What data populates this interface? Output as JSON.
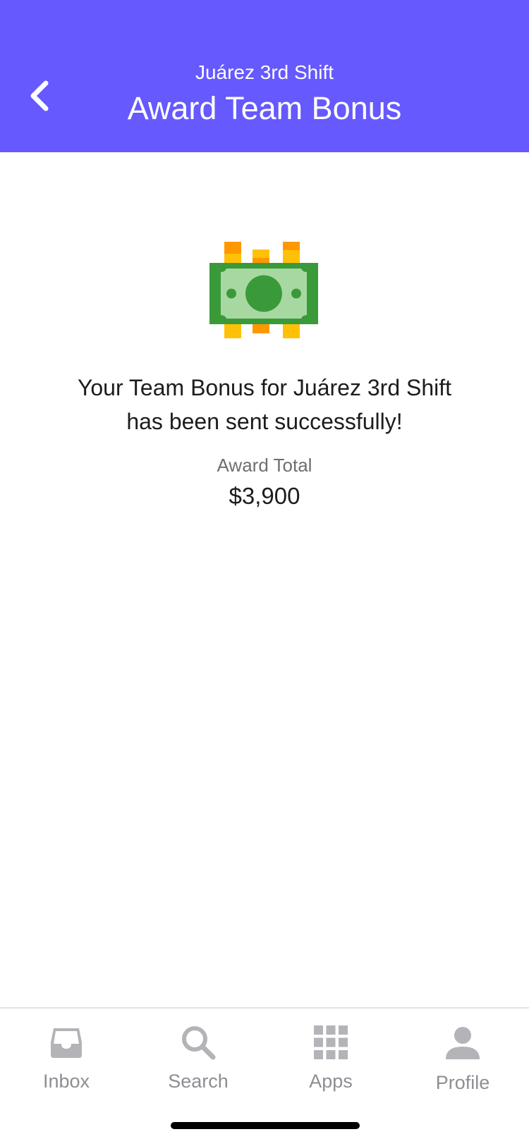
{
  "header": {
    "subtitle": "Juárez 3rd Shift",
    "title": "Award Team Bonus",
    "background_color": "#6659fd",
    "back_icon": "chevron-left-icon"
  },
  "main": {
    "icon": "money-bill-icon",
    "message_line1": "Your Team Bonus for Juárez 3rd Shift",
    "message_line2": "has been sent successfully!",
    "award_label": "Award Total",
    "award_value": "$3,900"
  },
  "tabs": [
    {
      "label": "Inbox",
      "icon": "inbox-icon"
    },
    {
      "label": "Search",
      "icon": "search-icon"
    },
    {
      "label": "Apps",
      "icon": "apps-grid-icon"
    },
    {
      "label": "Profile",
      "icon": "profile-icon"
    }
  ],
  "colors": {
    "accent": "#6659fd",
    "tab_inactive": "#8e8e93",
    "money_green_dark": "#3a9a3a",
    "money_green_light": "#a8d8a2",
    "coin_yellow": "#ffc107",
    "coin_orange": "#ff9800"
  }
}
